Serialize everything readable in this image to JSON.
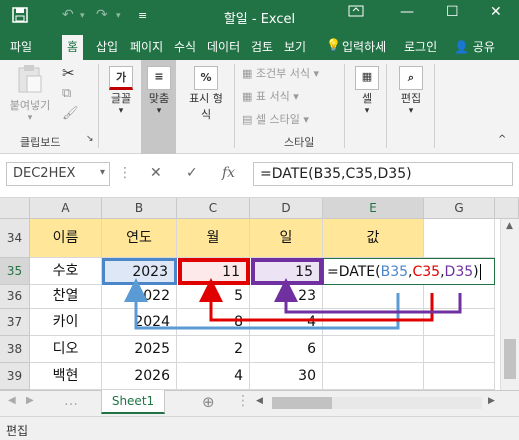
{
  "window": {
    "title": "할일 - Excel",
    "colors": {
      "brand": "#217346",
      "header_fill": "#ffe699"
    }
  },
  "ribbon_tabs": [
    "파일",
    "홈",
    "삽입",
    "페이지",
    "수식",
    "데이터",
    "검토",
    "보기"
  ],
  "tell_me": "입력하세",
  "account": {
    "signin": "로그인",
    "share": "공유"
  },
  "ribbon": {
    "clipboard": {
      "paste": "붙여넣기",
      "label": "클립보드"
    },
    "font": {
      "label": "글꼴"
    },
    "alignment": {
      "label": "맞춤"
    },
    "number": {
      "label1": "표시 형",
      "label2": "식"
    },
    "styles": {
      "conditional": "조건부 서식",
      "table": "표 서식",
      "cell_style": "셀 스타일",
      "label": "스타일"
    },
    "cells": {
      "label": "셀"
    },
    "editing": {
      "label": "편집"
    }
  },
  "formula_bar": {
    "name_box": "DEC2HEX",
    "formula": "=DATE(B35,C35,D35)"
  },
  "columns": [
    "A",
    "B",
    "C",
    "D",
    "E",
    "G"
  ],
  "rows": [
    {
      "num": "34",
      "a": "이름",
      "b": "연도",
      "c": "월",
      "d": "일",
      "e": "값"
    },
    {
      "num": "35",
      "a": "수호",
      "b": "2023",
      "c": "11",
      "d": "15",
      "e": "=DATE(B35,C35,D35)"
    },
    {
      "num": "36",
      "a": "찬열",
      "b": "2022",
      "c": "5",
      "d": "23",
      "e": ""
    },
    {
      "num": "37",
      "a": "카이",
      "b": "2024",
      "c": "8",
      "d": "4",
      "e": ""
    },
    {
      "num": "38",
      "a": "디오",
      "b": "2025",
      "c": "2",
      "d": "6",
      "e": ""
    },
    {
      "num": "39",
      "a": "백현",
      "b": "2026",
      "c": "4",
      "d": "30",
      "e": ""
    }
  ],
  "formula_parts": {
    "prefix": "=DATE(",
    "ref1": "B35",
    "comma1": ",",
    "ref2": "C35",
    "comma2": ",",
    "ref3": "D35",
    "suffix": ")"
  },
  "annotation_colors": {
    "blue": "#4a86c8",
    "red": "#e00000",
    "purple": "#7030a0",
    "arrow_blue": "#5b9bd5"
  },
  "sheet_tab": "Sheet1",
  "status": {
    "mode": "편집"
  }
}
